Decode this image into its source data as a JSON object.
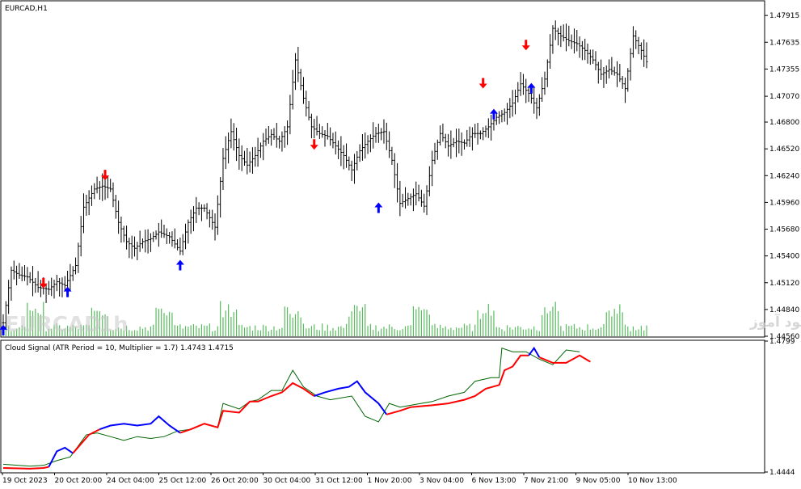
{
  "window": {
    "symbol_title": "EURCAD,H1",
    "indicator_title": "Cloud Signal (ATR Period = 10, Multiplier = 1.7) 1.4743 1.4715"
  },
  "watermark": {
    "symbol": "EURCAD",
    "timeframe": "1h",
    "text": "انتشار در سایت سود آموز"
  },
  "colors": {
    "background": "#ffffff",
    "frame": "#000000",
    "bars": "#000000",
    "volume": "#3cb043",
    "arrow_up": "#0000ff",
    "arrow_down": "#ff0000",
    "cloud_upper": "#006400",
    "cloud_bull": "#0000ff",
    "cloud_bear": "#ff0000"
  },
  "chart_data": [
    {
      "type": "candlestick-bars",
      "title": "EURCAD,H1",
      "ylim": [
        1.4456,
        1.4806
      ],
      "y_tick_labels": [
        "1.47915",
        "1.47635",
        "1.47355",
        "1.47070",
        "1.46800",
        "1.46520",
        "1.46240",
        "1.45960",
        "1.45680",
        "1.45400",
        "1.45120",
        "1.44840",
        "1.44560"
      ],
      "x_tick_labels": [
        "19 Oct 2023",
        "20 Oct 20:00",
        "24 Oct 04:00",
        "25 Oct 12:00",
        "26 Oct 20:00",
        "30 Oct 04:00",
        "31 Oct 12:00",
        "1 Nov 20:00",
        "3 Nov 04:00",
        "6 Nov 13:00",
        "7 Nov 21:00",
        "9 Nov 05:00",
        "10 Nov 13:00"
      ],
      "close_path": [
        [
          0,
          1.447
        ],
        [
          3,
          1.4525
        ],
        [
          6,
          1.452
        ],
        [
          9,
          1.4518
        ],
        [
          13,
          1.4507
        ],
        [
          17,
          1.4505
        ],
        [
          20,
          1.4513
        ],
        [
          23,
          1.4509
        ],
        [
          27,
          1.453
        ],
        [
          30,
          1.4591
        ],
        [
          34,
          1.461
        ],
        [
          37,
          1.4613
        ],
        [
          40,
          1.461
        ],
        [
          43,
          1.4575
        ],
        [
          46,
          1.4555
        ],
        [
          49,
          1.4548
        ],
        [
          52,
          1.4555
        ],
        [
          55,
          1.4558
        ],
        [
          58,
          1.4565
        ],
        [
          62,
          1.456
        ],
        [
          66,
          1.4545
        ],
        [
          69,
          1.4575
        ],
        [
          72,
          1.459
        ],
        [
          75,
          1.459
        ],
        [
          79,
          1.457
        ],
        [
          82,
          1.4642
        ],
        [
          85,
          1.467
        ],
        [
          88,
          1.4645
        ],
        [
          91,
          1.4635
        ],
        [
          94,
          1.4645
        ],
        [
          97,
          1.466
        ],
        [
          100,
          1.4667
        ],
        [
          103,
          1.466
        ],
        [
          106,
          1.4675
        ],
        [
          109,
          1.4745
        ],
        [
          112,
          1.4705
        ],
        [
          115,
          1.4675
        ],
        [
          118,
          1.4668
        ],
        [
          121,
          1.4665
        ],
        [
          124,
          1.4655
        ],
        [
          127,
          1.4645
        ],
        [
          130,
          1.463
        ],
        [
          133,
          1.465
        ],
        [
          136,
          1.466
        ],
        [
          139,
          1.4668
        ],
        [
          142,
          1.467
        ],
        [
          145,
          1.464
        ],
        [
          148,
          1.4595
        ],
        [
          151,
          1.46
        ],
        [
          154,
          1.4605
        ],
        [
          157,
          1.4592
        ],
        [
          160,
          1.464
        ],
        [
          163,
          1.4668
        ],
        [
          166,
          1.4655
        ],
        [
          169,
          1.466
        ],
        [
          172,
          1.4658
        ],
        [
          175,
          1.4668
        ],
        [
          178,
          1.4668
        ],
        [
          181,
          1.4675
        ],
        [
          184,
          1.4685
        ],
        [
          187,
          1.469
        ],
        [
          190,
          1.47
        ],
        [
          193,
          1.472
        ],
        [
          196,
          1.471
        ],
        [
          199,
          1.4695
        ],
        [
          202,
          1.4725
        ],
        [
          205,
          1.4778
        ],
        [
          208,
          1.477
        ],
        [
          211,
          1.4765
        ],
        [
          214,
          1.4762
        ],
        [
          217,
          1.4755
        ],
        [
          220,
          1.4745
        ],
        [
          223,
          1.473
        ],
        [
          226,
          1.4735
        ],
        [
          229,
          1.473
        ],
        [
          232,
          1.4715
        ],
        [
          235,
          1.477
        ],
        [
          238,
          1.4755
        ],
        [
          240,
          1.4743
        ]
      ],
      "x_range_bars": [
        0,
        240
      ],
      "signal_arrows": [
        {
          "type": "up",
          "bar": 0,
          "price": 1.4462
        },
        {
          "type": "down",
          "bar": 15,
          "price": 1.4512
        },
        {
          "type": "up",
          "bar": 24,
          "price": 1.4502
        },
        {
          "type": "down",
          "bar": 38,
          "price": 1.4625
        },
        {
          "type": "up",
          "bar": 66,
          "price": 1.453
        },
        {
          "type": "down",
          "bar": 116,
          "price": 1.4657
        },
        {
          "type": "up",
          "bar": 140,
          "price": 1.459
        },
        {
          "type": "down",
          "bar": 179,
          "price": 1.4721
        },
        {
          "type": "up",
          "bar": 183,
          "price": 1.4688
        },
        {
          "type": "down",
          "bar": 195,
          "price": 1.4761
        },
        {
          "type": "up",
          "bar": 197,
          "price": 1.4715
        }
      ]
    },
    {
      "type": "line",
      "title": "Cloud Signal (ATR Period = 10, Multiplier = 1.7) 1.4743 1.4715",
      "ylim": [
        1.4444,
        1.4799
      ],
      "y_tick_labels": [
        "1.4799",
        "1.4444"
      ],
      "series": [
        {
          "key": "upper",
          "color": "#006400",
          "values": [
            [
              0,
              1.4465
            ],
            [
              10,
              1.446
            ],
            [
              15,
              1.4462
            ],
            [
              20,
              1.4475
            ],
            [
              25,
              1.4485
            ],
            [
              31,
              1.4545
            ],
            [
              35,
              1.455
            ],
            [
              40,
              1.454
            ],
            [
              45,
              1.453
            ],
            [
              50,
              1.454
            ],
            [
              55,
              1.4535
            ],
            [
              60,
              1.454
            ],
            [
              65,
              1.4555
            ],
            [
              70,
              1.456
            ],
            [
              75,
              1.4575
            ],
            [
              80,
              1.4565
            ],
            [
              82,
              1.463
            ],
            [
              88,
              1.4615
            ],
            [
              92,
              1.4635
            ],
            [
              95,
              1.464
            ],
            [
              100,
              1.4665
            ],
            [
              104,
              1.4665
            ],
            [
              108,
              1.472
            ],
            [
              112,
              1.4675
            ],
            [
              117,
              1.465
            ],
            [
              122,
              1.464
            ],
            [
              130,
              1.465
            ],
            [
              135,
              1.4595
            ],
            [
              140,
              1.458
            ],
            [
              144,
              1.463
            ],
            [
              148,
              1.462
            ],
            [
              152,
              1.4625
            ],
            [
              160,
              1.4635
            ],
            [
              166,
              1.465
            ],
            [
              172,
              1.466
            ],
            [
              176,
              1.469
            ],
            [
              182,
              1.47
            ],
            [
              185,
              1.47
            ],
            [
              186,
              1.478
            ],
            [
              190,
              1.477
            ],
            [
              195,
              1.477
            ],
            [
              200,
              1.475
            ],
            [
              205,
              1.4735
            ],
            [
              210,
              1.4775
            ],
            [
              215,
              1.477
            ]
          ]
        },
        {
          "key": "lower",
          "segments": [
            {
              "color": "#ff0000",
              "values": [
                [
                  0,
                  1.4455
                ],
                [
                  10,
                  1.4453
                ],
                [
                  15,
                  1.4455
                ],
                [
                  17,
                  1.4458
                ]
              ]
            },
            {
              "color": "#0000ff",
              "values": [
                [
                  17,
                  1.4458
                ],
                [
                  20,
                  1.45
                ],
                [
                  23,
                  1.451
                ],
                [
                  26,
                  1.4495
                ]
              ]
            },
            {
              "color": "#ff0000",
              "values": [
                [
                  26,
                  1.4495
                ],
                [
                  32,
                  1.4545
                ],
                [
                  36,
                  1.456
                ]
              ]
            },
            {
              "color": "#0000ff",
              "values": [
                [
                  36,
                  1.456
                ],
                [
                  40,
                  1.457
                ],
                [
                  45,
                  1.4575
                ],
                [
                  50,
                  1.457
                ],
                [
                  55,
                  1.4575
                ],
                [
                  58,
                  1.4595
                ],
                [
                  62,
                  1.457
                ],
                [
                  66,
                  1.455
                ]
              ]
            },
            {
              "color": "#ff0000",
              "values": [
                [
                  66,
                  1.455
                ],
                [
                  70,
                  1.456
                ],
                [
                  75,
                  1.4575
                ],
                [
                  80,
                  1.4565
                ],
                [
                  82,
                  1.461
                ],
                [
                  88,
                  1.4605
                ],
                [
                  92,
                  1.4635
                ],
                [
                  95,
                  1.4635
                ],
                [
                  100,
                  1.465
                ],
                [
                  104,
                  1.466
                ],
                [
                  108,
                  1.4685
                ],
                [
                  112,
                  1.467
                ],
                [
                  116,
                  1.465
                ]
              ]
            },
            {
              "color": "#0000ff",
              "values": [
                [
                  116,
                  1.465
                ],
                [
                  120,
                  1.466
                ],
                [
                  125,
                  1.467
                ],
                [
                  129,
                  1.4675
                ],
                [
                  132,
                  1.469
                ],
                [
                  135,
                  1.466
                ],
                [
                  140,
                  1.463
                ],
                [
                  143,
                  1.46
                ]
              ]
            },
            {
              "color": "#ff0000",
              "values": [
                [
                  143,
                  1.46
                ],
                [
                  148,
                  1.461
                ],
                [
                  152,
                  1.462
                ],
                [
                  160,
                  1.4625
                ],
                [
                  166,
                  1.463
                ],
                [
                  172,
                  1.464
                ],
                [
                  176,
                  1.465
                ],
                [
                  180,
                  1.467
                ],
                [
                  185,
                  1.468
                ],
                [
                  187,
                  1.472
                ],
                [
                  190,
                  1.473
                ],
                [
                  193,
                  1.476
                ],
                [
                  196,
                  1.476
                ]
              ]
            },
            {
              "color": "#0000ff",
              "values": [
                [
                  196,
                  1.476
                ],
                [
                  198,
                  1.478
                ],
                [
                  200,
                  1.4755
                ]
              ]
            },
            {
              "color": "#ff0000",
              "values": [
                [
                  200,
                  1.4755
                ],
                [
                  205,
                  1.474
                ],
                [
                  210,
                  1.474
                ],
                [
                  215,
                  1.476
                ],
                [
                  219,
                  1.4743
                ]
              ]
            }
          ]
        }
      ]
    }
  ]
}
